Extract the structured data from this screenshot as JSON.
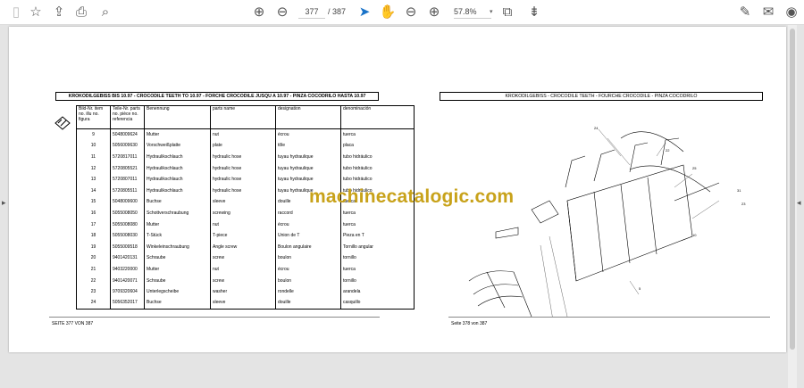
{
  "toolbar": {
    "page_current": "377",
    "page_total": "/ 387",
    "zoom": "57.8%",
    "icons": [
      "save-icon",
      "bookmark-star-icon",
      "upload-icon",
      "print-icon",
      "search-icon",
      "page-up-icon",
      "page-down-icon",
      "select-cursor-icon",
      "hand-icon",
      "zoom-out-icon",
      "zoom-in-icon",
      "page-fit-icon",
      "scroll-mode-icon",
      "sign-icon",
      "mail-icon",
      "account-icon"
    ]
  },
  "left_page": {
    "title": "KROKODILGEBISS BIS 10.97 - CROCODILE TEETH TO 10.97 - FORCHE CROCODILE JUSQU A 10.97 - PINZA COCODRILO HASTA 10.97",
    "headers": [
      "Bild-Nr. item no. illu no. figura",
      "Teile-Nr. parts no. pièce no. referencia",
      "Benennung",
      "parts name",
      "designation",
      "denominación"
    ],
    "rows": [
      [
        "9",
        "5048009624",
        "Mutter",
        "nut",
        "écrou",
        "tuerca"
      ],
      [
        "10",
        "5056009630",
        "Vorschweißplatte",
        "plate",
        "tôle",
        "placa"
      ],
      [
        "11",
        "5720817011",
        "Hydraulikschlauch",
        "hydraulic hose",
        "tuyau hydraulique",
        "tubo hidráulico"
      ],
      [
        "12",
        "5720805521",
        "Hydraulikschlauch",
        "hydraulic hose",
        "tuyau hydraulique",
        "tubo hidráulico"
      ],
      [
        "13",
        "5720807011",
        "Hydraulikschlauch",
        "hydraulic hose",
        "tuyau hydraulique",
        "tubo hidráulico"
      ],
      [
        "14",
        "5720805511",
        "Hydraulikschlauch",
        "hydraulic hose",
        "tuyau hydraulique",
        "tubo hidráulico"
      ],
      [
        "15",
        "5048009600",
        "Buchse",
        "sleeve",
        "douille",
        "tuerca"
      ],
      [
        "16",
        "5055008050",
        "Schottverschraubung",
        "screwing",
        "raccord",
        "tuerca"
      ],
      [
        "17",
        "5055008080",
        "Mutter",
        "nut",
        "écrou",
        "tuerca"
      ],
      [
        "18",
        "5055008030",
        "T-Stück",
        "T-piece",
        "Union de T",
        "Pieza en T"
      ],
      [
        "19",
        "5055009518",
        "Winkeleinschraubung",
        "Angle screw",
        "Boulon angulaire",
        "Tornillo angular"
      ],
      [
        "20",
        "9401420131",
        "Schraube",
        "screw",
        "boulon",
        "tornillo"
      ],
      [
        "21",
        "9403220000",
        "Mutter",
        "nut",
        "écrou",
        "tuerca"
      ],
      [
        "22",
        "9401420071",
        "Schraube",
        "screw",
        "boulon",
        "tornillo"
      ],
      [
        "23",
        "9709320604",
        "Unterlegscheibe",
        "washer",
        "rondelle",
        "arandela"
      ],
      [
        "24",
        "5056352017",
        "Buchse",
        "sleeve",
        "douille",
        "casquillo"
      ]
    ],
    "footer": "SEITE 377 VON 387"
  },
  "right_page": {
    "title": "KROKODILGEBISS - CROCODILE TEETH - FOURCHE CROCODILE - PINZA COCODRILO",
    "footer": "Seite 378 von 387"
  },
  "watermark": "machinecatalogic.com"
}
